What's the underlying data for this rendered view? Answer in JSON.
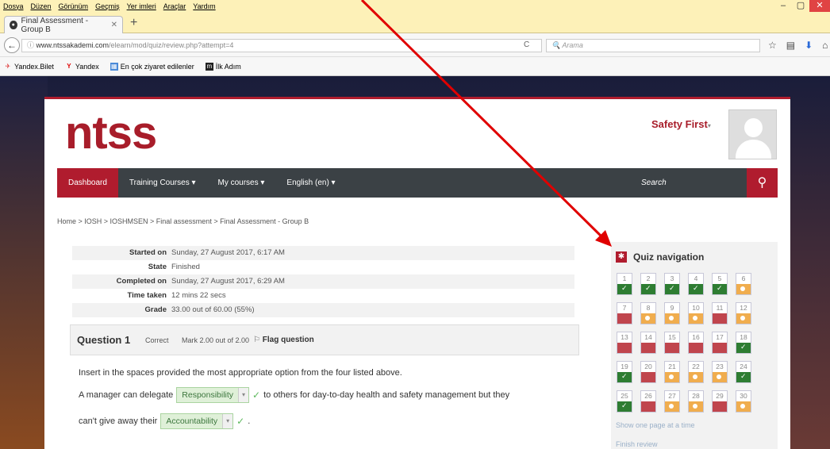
{
  "browser": {
    "menu": [
      "Dosya",
      "Düzen",
      "Görünüm",
      "Geçmiş",
      "Yer imleri",
      "Araçlar",
      "Yardım"
    ],
    "window_controls": [
      "–",
      "▢",
      "✕"
    ],
    "tab_title": "Final Assessment - Group B",
    "tab_close": "✕",
    "new_tab": "+",
    "url_domain": "www.ntssakademi.com",
    "url_path": "/elearn/mod/quiz/review.php?attempt=4",
    "search_placeholder": "Arama",
    "bookmarks": [
      "Yandex.Bilet",
      "Yandex",
      "En çok ziyaret edilenler",
      "İlk Adım"
    ]
  },
  "site": {
    "logo": "ntss",
    "user_name": "Safety First",
    "nav": [
      "Dashboard",
      "Training Courses ▾",
      "My courses ▾",
      "English (en) ▾"
    ],
    "search_placeholder": "Search",
    "breadcrumb": "Home  >  IOSH  >  IOSHMSEN  >  Final assessment  >  Final Assessment - Group B"
  },
  "summary": [
    {
      "label": "Started on",
      "value": "Sunday, 27 August 2017, 6:17 AM"
    },
    {
      "label": "State",
      "value": "Finished"
    },
    {
      "label": "Completed on",
      "value": "Sunday, 27 August 2017, 6:29 AM"
    },
    {
      "label": "Time taken",
      "value": "12 mins 22 secs"
    },
    {
      "label": "Grade",
      "value": "33.00 out of 60.00 (55%)"
    }
  ],
  "question": {
    "number": "Question 1",
    "status": "Correct",
    "mark": "Mark 2.00 out of 2.00",
    "flag": "Flag question",
    "instruction": "Insert in the spaces provided the most appropriate option from the four listed above.",
    "line1_pre": "A manager can delegate",
    "answer1": "Responsibility",
    "line1_post": "to others for day-to-day health and safety management but they",
    "line2_pre": "can't give away their",
    "answer2": "Accountability",
    "line2_post": "."
  },
  "quiz_nav": {
    "title": "Quiz navigation",
    "questions": [
      {
        "n": "1",
        "s": "correct"
      },
      {
        "n": "2",
        "s": "correct"
      },
      {
        "n": "3",
        "s": "correct"
      },
      {
        "n": "4",
        "s": "correct"
      },
      {
        "n": "5",
        "s": "correct"
      },
      {
        "n": "6",
        "s": "partial"
      },
      {
        "n": "7",
        "s": "incorrect"
      },
      {
        "n": "8",
        "s": "partial"
      },
      {
        "n": "9",
        "s": "partial"
      },
      {
        "n": "10",
        "s": "partial"
      },
      {
        "n": "11",
        "s": "incorrect"
      },
      {
        "n": "12",
        "s": "partial"
      },
      {
        "n": "13",
        "s": "incorrect"
      },
      {
        "n": "14",
        "s": "incorrect"
      },
      {
        "n": "15",
        "s": "incorrect"
      },
      {
        "n": "16",
        "s": "incorrect"
      },
      {
        "n": "17",
        "s": "incorrect"
      },
      {
        "n": "18",
        "s": "correct"
      },
      {
        "n": "19",
        "s": "correct"
      },
      {
        "n": "20",
        "s": "incorrect"
      },
      {
        "n": "21",
        "s": "partial"
      },
      {
        "n": "22",
        "s": "partial"
      },
      {
        "n": "23",
        "s": "partial"
      },
      {
        "n": "24",
        "s": "correct"
      },
      {
        "n": "25",
        "s": "correct"
      },
      {
        "n": "26",
        "s": "incorrect"
      },
      {
        "n": "27",
        "s": "partial"
      },
      {
        "n": "28",
        "s": "partial"
      },
      {
        "n": "29",
        "s": "incorrect"
      },
      {
        "n": "30",
        "s": "partial"
      }
    ],
    "show_one_page": "Show one page at a time",
    "finish_review": "Finish review"
  },
  "colors": {
    "brand": "#a81d2a",
    "correct": "#2e7d32",
    "incorrect": "#c0454d",
    "partial": "#f0ad4e",
    "annotation_arrow": "#e00000"
  }
}
